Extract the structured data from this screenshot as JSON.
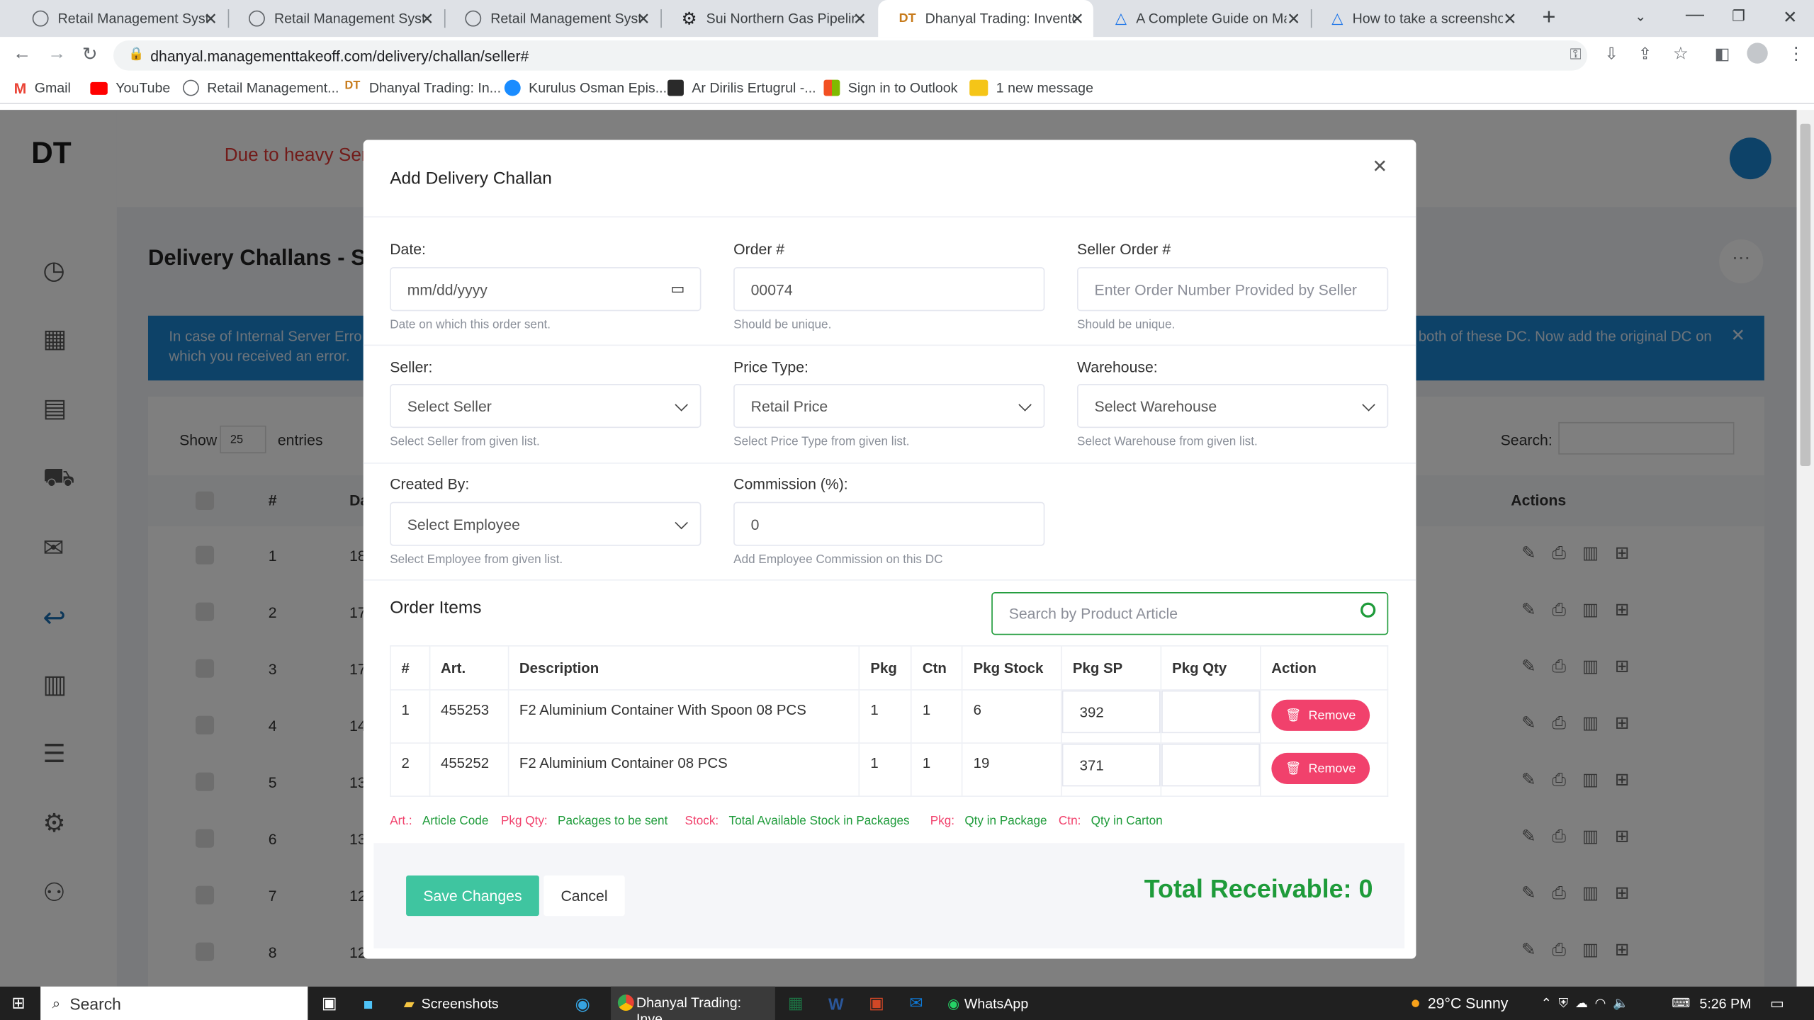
{
  "browser": {
    "tabs": [
      {
        "title": "Retail Management System"
      },
      {
        "title": "Retail Management System"
      },
      {
        "title": "Retail Management System"
      },
      {
        "title": "Sui Northern Gas Pipelines"
      },
      {
        "title": "Dhanyal Trading: Inventory"
      },
      {
        "title": "A Complete Guide on Making"
      },
      {
        "title": "How to take a screenshot"
      }
    ],
    "url": "dhanyal.managementtakeoff.com/delivery/challan/seller#",
    "bookmarks": [
      "Gmail",
      "YouTube",
      "Retail Management...",
      "Dhanyal Trading: In...",
      "Kurulus Osman Epis...",
      "Ar Dirilis Ertugrul -...",
      "Sign in to Outlook",
      "1 new message"
    ]
  },
  "background_page": {
    "marquee": "Due to heavy Ser",
    "title": "Delivery Challans - Sel",
    "alert_left_1": "In case of Internal Server Erro",
    "alert_left_2": "which you received an error.",
    "alert_right": "both of these DC. Now add the original DC on",
    "show_label": "Show",
    "entries_value": "25",
    "entries_label": "entries",
    "search_label": "Search:",
    "col_hash": "#",
    "col_d": "Da",
    "col_actions": "Actions",
    "rows": [
      {
        "num": "1",
        "date": "18"
      },
      {
        "num": "2",
        "date": "17-"
      },
      {
        "num": "3",
        "date": "17-"
      },
      {
        "num": "4",
        "date": "14"
      },
      {
        "num": "5",
        "date": "13"
      },
      {
        "num": "6",
        "date": "13-"
      },
      {
        "num": "7",
        "date": "12-"
      },
      {
        "num": "8",
        "date": "12-"
      }
    ]
  },
  "modal": {
    "title": "Add Delivery Challan",
    "date": {
      "label": "Date:",
      "placeholder": "mm/dd/yyyy",
      "help": "Date on which this order sent."
    },
    "order": {
      "label": "Order #",
      "value": "00074",
      "help": "Should be unique."
    },
    "seller_order": {
      "label": "Seller Order #",
      "placeholder": "Enter Order Number Provided by Seller",
      "help": "Should be unique."
    },
    "seller": {
      "label": "Seller:",
      "value": "Select Seller",
      "help": "Select Seller from given list."
    },
    "price_type": {
      "label": "Price Type:",
      "value": "Retail Price",
      "help": "Select Price Type from given list."
    },
    "warehouse": {
      "label": "Warehouse:",
      "value": "Select Warehouse",
      "help": "Select Warehouse from given list."
    },
    "created_by": {
      "label": "Created By:",
      "value": "Select Employee",
      "help": "Select Employee from given list."
    },
    "commission": {
      "label": "Commission (%):",
      "value": "0",
      "help": "Add Employee Commission on this DC"
    },
    "order_items_title": "Order Items",
    "product_search_placeholder": "Search by Product Article",
    "columns": [
      "#",
      "Art.",
      "Description",
      "Pkg",
      "Ctn",
      "Pkg Stock",
      "Pkg SP",
      "Pkg Qty",
      "Action"
    ],
    "items": [
      {
        "num": "1",
        "art": "455253",
        "desc": "F2 Aluminium Container With Spoon 08 PCS",
        "pkg": "1",
        "ctn": "1",
        "stock": "6",
        "sp": "392",
        "qty": "",
        "action": "Remove"
      },
      {
        "num": "2",
        "art": "455252",
        "desc": "F2 Aluminium Container 08 PCS",
        "pkg": "1",
        "ctn": "1",
        "stock": "19",
        "sp": "371",
        "qty": "",
        "action": "Remove"
      }
    ],
    "legend": [
      {
        "key": "Art.:",
        "value": "Article Code"
      },
      {
        "key": "Pkg Qty:",
        "value": "Packages to be sent"
      },
      {
        "key": "Stock:",
        "value": "Total Available Stock in Packages"
      },
      {
        "key": "Pkg:",
        "value": "Qty in Package"
      },
      {
        "key": "Ctn:",
        "value": "Qty in Carton"
      }
    ],
    "save_label": "Save Changes",
    "cancel_label": "Cancel",
    "total_label": "Total Receivable: 0"
  },
  "taskbar": {
    "search": "Search",
    "items": [
      "Screenshots",
      "Dhanyal Trading: Inve...",
      "WhatsApp"
    ],
    "weather": "29°C  Sunny",
    "time": "5:26 PM"
  },
  "colors": {
    "accent_green": "#1e9b3a",
    "teal": "#3fc5a0",
    "danger": "#f1416c",
    "alert_blue": "#1b84d0"
  }
}
